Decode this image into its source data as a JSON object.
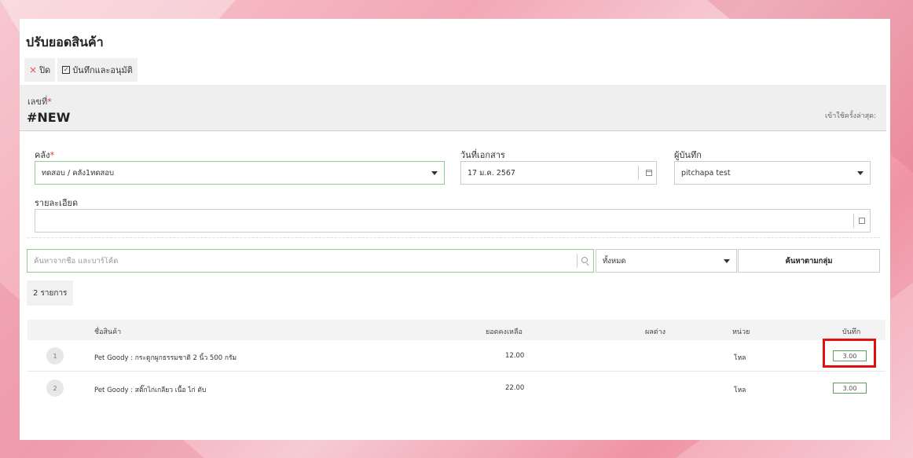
{
  "page": {
    "title": "ปรับยอดสินค้า"
  },
  "toolbar": {
    "close_label": "ปิด",
    "save_label": "บันทึกและอนุมัติ"
  },
  "document": {
    "number_label": "เลขที่",
    "number_value": "#NEW",
    "right_hint": "เข้าใช้ครั้งล่าสุด:"
  },
  "form": {
    "warehouse_label": "คลัง",
    "warehouse_value": "ทดสอบ / คลัง1ทดสอบ",
    "doc_date_label": "วันที่เอกสาร",
    "doc_date_value": "17 ม.ค. 2567",
    "recorder_label": "ผู้บันทึก",
    "recorder_value": "pitchapa test",
    "detail_label": "รายละเอียด",
    "detail_value": ""
  },
  "search": {
    "placeholder": "ค้นหาจากชื่อ และบาร์โค้ด",
    "group_value": "ทั้งหมด",
    "group_button_label": "ค้นหาตามกลุ่ม"
  },
  "summary": {
    "count_label": "2 รายการ"
  },
  "table": {
    "headers": {
      "name": "ชื่อสินค้า",
      "balance": "ยอดคงเหลือ",
      "diff": "ผลต่าง",
      "unit": "หน่วย",
      "recorded": "บันทึก"
    },
    "rows": [
      {
        "index": "1",
        "name": "Pet Goody : กระดูกผูกธรรมชาติ 2 นิ้ว 500 กรัม",
        "balance": "12.00",
        "diff": "",
        "unit": "โหล",
        "recorded": "3.00"
      },
      {
        "index": "2",
        "name": "Pet Goody : สติ๊กไก่เกลียว เนื้อ ไก่ ตับ",
        "balance": "22.00",
        "diff": "",
        "unit": "โหล",
        "recorded": "3.00"
      }
    ]
  },
  "colors": {
    "highlight": "#e01010",
    "accent_green": "#5aa05a"
  }
}
